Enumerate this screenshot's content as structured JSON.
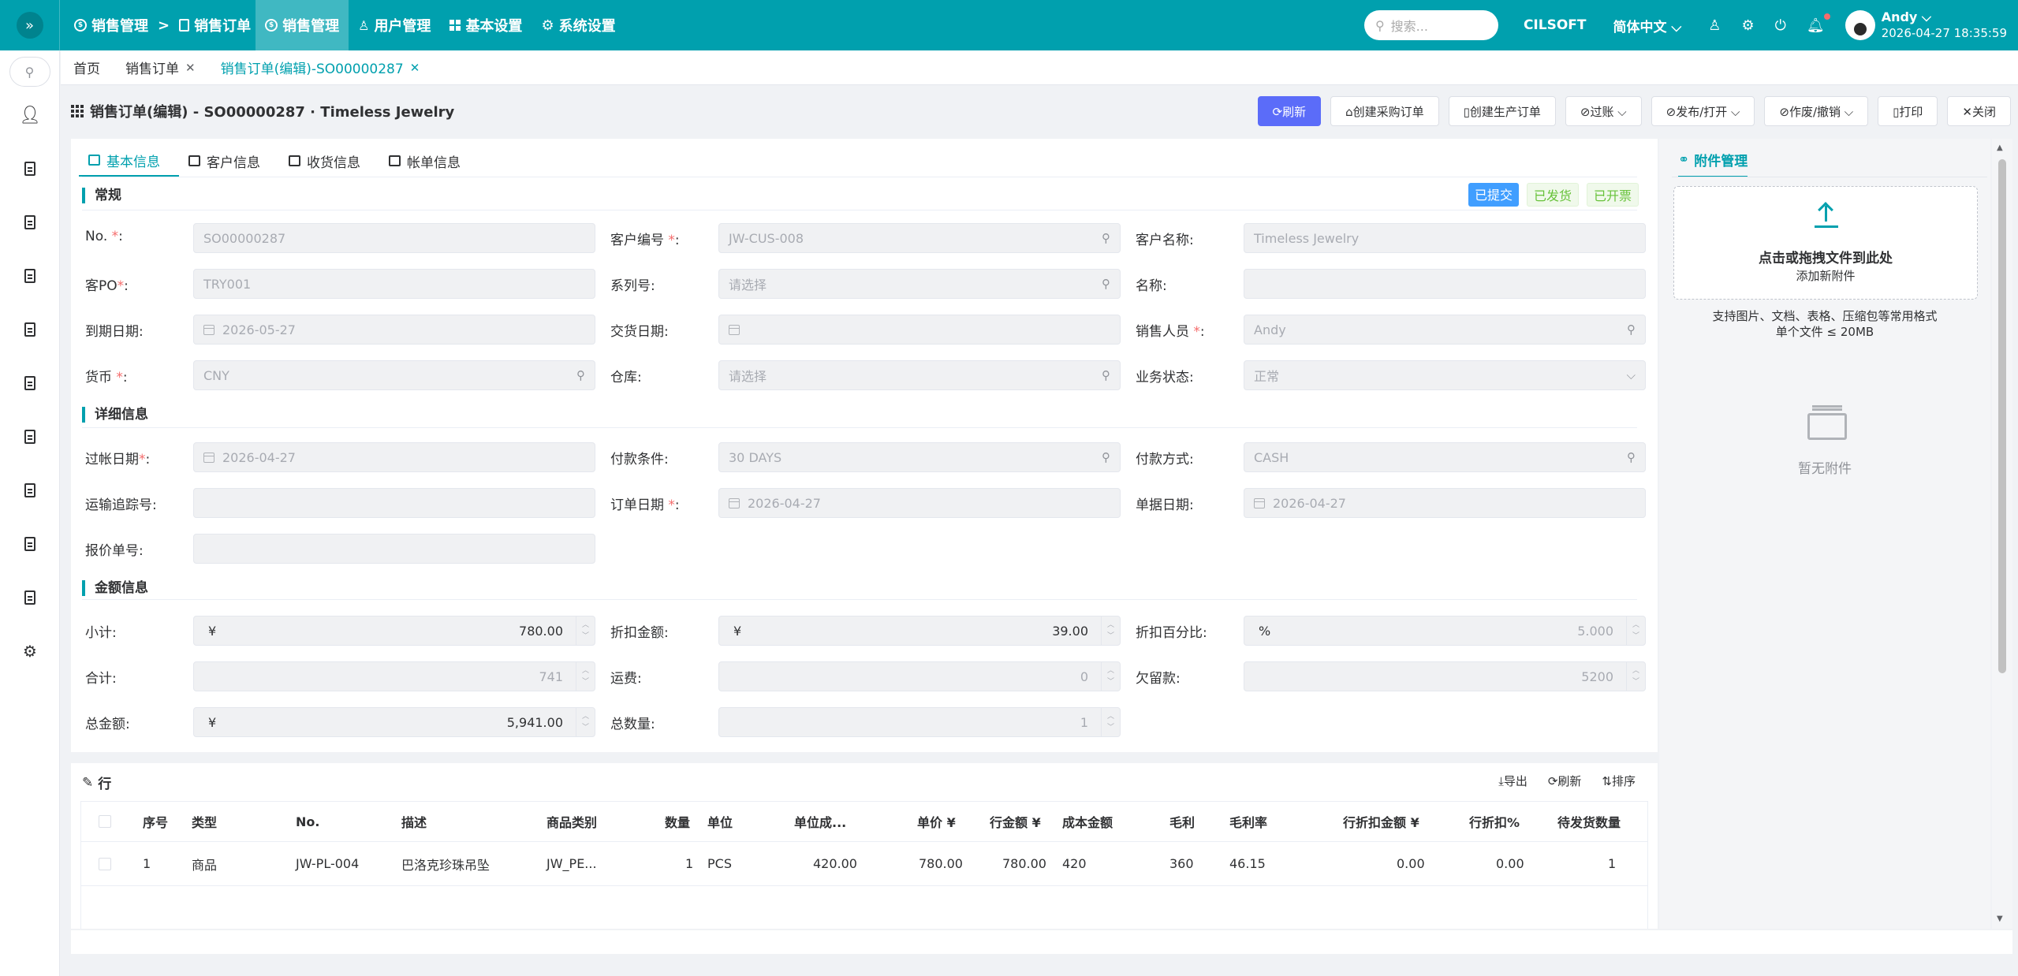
{
  "topbar": {
    "breadcrumbs": [
      "销售管理",
      ">",
      "销售订单"
    ],
    "nav": [
      {
        "label": "销售管理",
        "active": true
      },
      {
        "label": "用户管理",
        "active": false
      },
      {
        "label": "基本设置",
        "active": false
      },
      {
        "label": "系统设置",
        "active": false
      }
    ],
    "search_placeholder": "搜索...",
    "company": "CILSOFT",
    "language": "简体中文 ⌵",
    "username": "Andy ⌵",
    "datetime": "2026-04-27 18:35:59"
  },
  "tabs": [
    {
      "label": "首页",
      "closable": false
    },
    {
      "label": "销售订单",
      "closable": true
    },
    {
      "label": "销售订单(编辑)-SO00000287",
      "closable": true,
      "active": true
    }
  ],
  "page": {
    "title": "销售订单(编辑) - SO00000287 · Timeless Jewelry",
    "actions": {
      "refresh": "⟳刷新",
      "create_po": "⌂创建采购订单",
      "create_mo": "▯创建生产订单",
      "post": "⊘过账 ⌵",
      "publish": "⊘发布/打开 ⌵",
      "void": "⊘作废/撤销 ⌵",
      "print": "▯打印",
      "close": "✕关闭"
    }
  },
  "form_tabs": [
    "基本信息",
    "客户信息",
    "收货信息",
    "帐单信息"
  ],
  "statuses": [
    "已提交",
    "已发货",
    "已开票"
  ],
  "sections": {
    "general": "常规",
    "detail": "详细信息",
    "amount": "金额信息"
  },
  "fields": {
    "no": {
      "label": "No.",
      "value": "SO00000287"
    },
    "cust_no": {
      "label": "客户编号",
      "value": "JW-CUS-008"
    },
    "cust_name": {
      "label": "客户名称:",
      "value": "Timeless Jewelry"
    },
    "cust_po": {
      "label": "客PO",
      "value": "TRY001"
    },
    "serial": {
      "label": "系列号:",
      "placeholder": "请选择"
    },
    "name": {
      "label": "名称:",
      "value": ""
    },
    "due_date": {
      "label": "到期日期:",
      "value": "2026-05-27"
    },
    "delivery_date": {
      "label": "交货日期:",
      "value": ""
    },
    "salesperson": {
      "label": "销售人员",
      "value": "Andy"
    },
    "currency": {
      "label": "货币",
      "value": "CNY"
    },
    "warehouse": {
      "label": "仓库:",
      "placeholder": "请选择"
    },
    "biz_status": {
      "label": "业务状态:",
      "value": "正常"
    },
    "posting_date": {
      "label": "过帐日期",
      "value": "2026-04-27"
    },
    "pay_terms": {
      "label": "付款条件:",
      "value": "30 DAYS"
    },
    "pay_method": {
      "label": "付款方式:",
      "value": "CASH"
    },
    "tracking": {
      "label": "运输追踪号:",
      "value": ""
    },
    "order_date": {
      "label": "订单日期",
      "value": "2026-04-27"
    },
    "doc_date": {
      "label": "单据日期:",
      "value": "2026-04-27"
    },
    "quote_no": {
      "label": "报价单号:",
      "value": ""
    },
    "subtotal": {
      "label": "小计:",
      "currency": "¥",
      "value": "780.00"
    },
    "discount_amt": {
      "label": "折扣金额:",
      "currency": "¥",
      "value": "39.00"
    },
    "discount_pct": {
      "label": "折扣百分比:",
      "currency": "%",
      "value": "5.000"
    },
    "total": {
      "label": "合计:",
      "value": "741"
    },
    "freight": {
      "label": "运费:",
      "value": "0"
    },
    "balance": {
      "label": "欠留款:",
      "value": "5200"
    },
    "grand_total": {
      "label": "总金额:",
      "currency": "¥",
      "value": "5,941.00"
    },
    "total_qty": {
      "label": "总数量:",
      "value": "1"
    }
  },
  "lines": {
    "title": "行",
    "actions": {
      "export": "⤓导出",
      "refresh": "⟳刷新",
      "sort": "⇅排序"
    },
    "columns": [
      "序号",
      "类型",
      "No.",
      "描述",
      "商品类别",
      "数量",
      "单位",
      "单位成...",
      "单价 ¥",
      "行金额 ¥",
      "成本金额",
      "毛利",
      "毛利率",
      "行折扣金额 ¥",
      "行折扣%",
      "待发货数量"
    ],
    "rows": [
      [
        "1",
        "商品",
        "JW-PL-004",
        "巴洛克珍珠吊坠",
        "JW_PE...",
        "1",
        "PCS",
        "420.00",
        "780.00",
        "780.00",
        "420",
        "360",
        "46.15",
        "0.00",
        "0.00",
        "1"
      ]
    ]
  },
  "attachments": {
    "tab": "附件管理",
    "drop_main": "点击或拖拽文件到此处",
    "drop_sub": "添加新附件",
    "hint1": "支持图片、文档、表格、压缩包等常用格式",
    "hint2": "单个文件 ≤ 20MB",
    "empty": "暂无附件"
  },
  "colors": {
    "brand": "#00a0ae",
    "primary_button": "#5b6cf9",
    "required": "#f56c6c"
  }
}
